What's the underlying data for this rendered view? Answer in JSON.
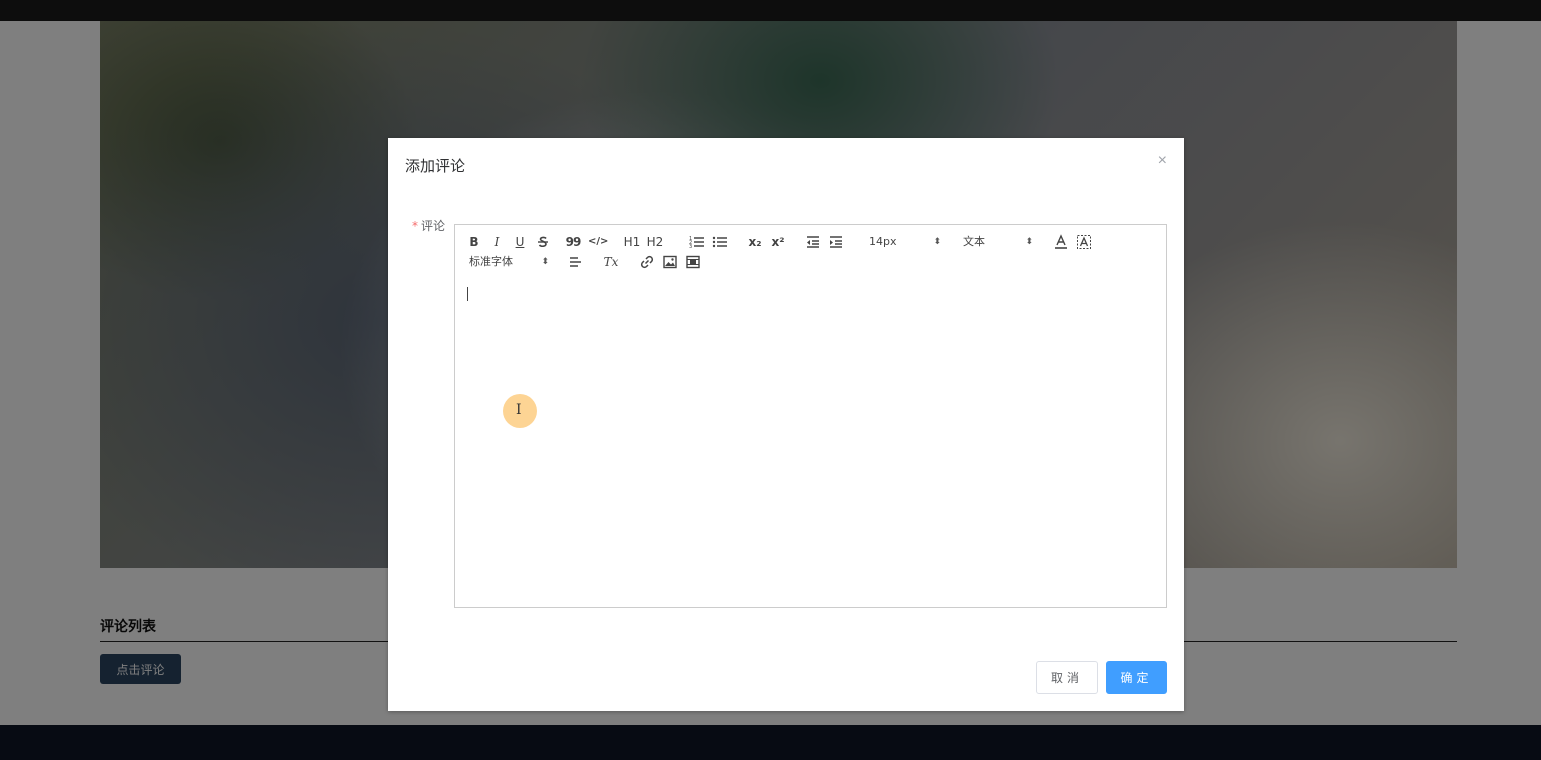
{
  "page": {
    "section_title": "评论列表",
    "comment_button": "点击评论"
  },
  "dialog": {
    "title": "添加评论",
    "close_label": "×",
    "field_required_mark": "*",
    "field_label": "评论",
    "cancel_label": "取消",
    "confirm_label": "确定"
  },
  "toolbar": {
    "bold": "B",
    "italic": "I",
    "underline": "U",
    "quote": "99",
    "code": "</>",
    "h1": "H1",
    "h2": "H2",
    "subscript": "x₂",
    "superscript": "x²",
    "size_picker": "14px",
    "header_picker": "文本",
    "font_picker": "标准字体",
    "picker_arrow": "⬍",
    "clean_format": "Tx"
  },
  "colors": {
    "primary": "#409eff",
    "required": "#f56c6c",
    "comment_button_bg": "#2a4560"
  }
}
